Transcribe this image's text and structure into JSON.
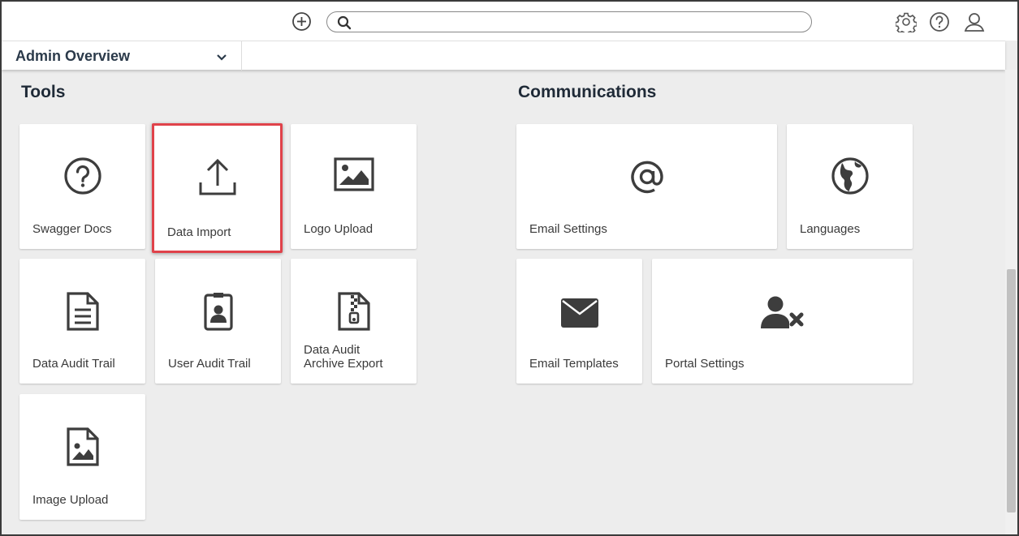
{
  "search": {
    "value": "",
    "placeholder": ""
  },
  "header": {
    "add_icon": "plus-circle-icon",
    "search_icon": "search-icon",
    "more_icon": "more-options-icon",
    "settings_icon": "gear-icon",
    "help_icon": "help-icon",
    "profile_icon": "user-icon"
  },
  "dashboard_selector": {
    "label": "Admin Overview"
  },
  "sections": {
    "tools": {
      "title": "Tools",
      "tiles": [
        {
          "label": "Swagger Docs",
          "icon": "question-circle-icon"
        },
        {
          "label": "Data Import",
          "icon": "upload-icon"
        },
        {
          "label": "Logo Upload",
          "icon": "image-icon"
        },
        {
          "label": "Data Audit Trail",
          "icon": "document-icon"
        },
        {
          "label": "User Audit Trail",
          "icon": "id-badge-icon"
        },
        {
          "label": "Data Audit Archive Export",
          "icon": "zip-file-icon"
        },
        {
          "label": "Image Upload",
          "icon": "image-file-icon"
        }
      ]
    },
    "communications": {
      "title": "Communications",
      "tiles": [
        {
          "label": "Email Settings",
          "icon": "at-sign-icon"
        },
        {
          "label": "Languages",
          "icon": "globe-icon"
        },
        {
          "label": "Email Templates",
          "icon": "envelope-icon"
        },
        {
          "label": "Portal Settings",
          "icon": "user-remove-icon"
        }
      ]
    }
  },
  "highlight": {
    "tile": "Data Import",
    "color": "#e0424a"
  },
  "colors": {
    "background": "#ededed",
    "tile": "#ffffff",
    "icon": "#3d3d3d",
    "title": "#1f2a37"
  }
}
